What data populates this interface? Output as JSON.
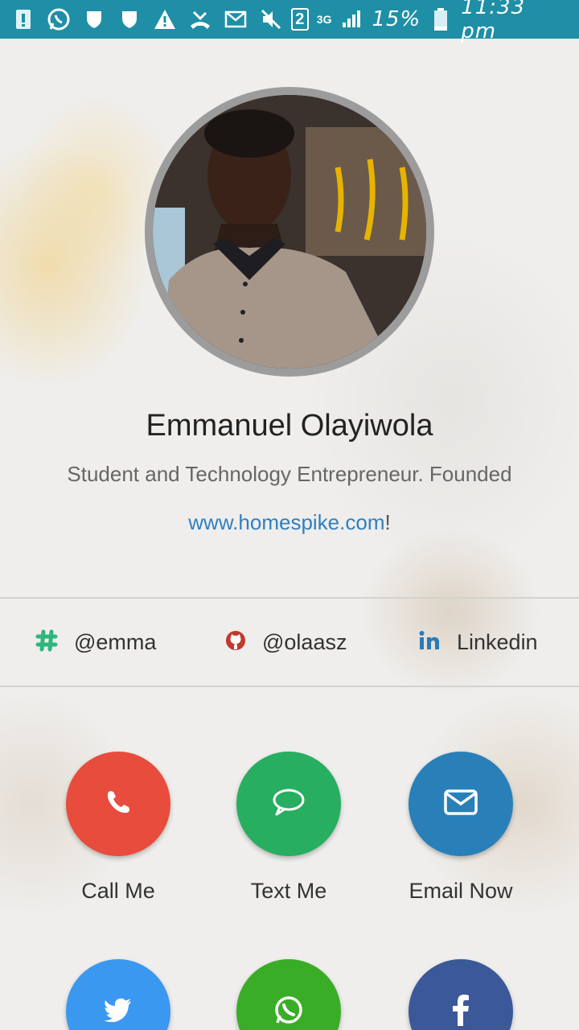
{
  "status_bar": {
    "battery_percent": "15%",
    "time": "11:33 pm",
    "network": "3G",
    "sim_slot": "2",
    "background_color": "#1e8fa6"
  },
  "profile": {
    "name": "Emmanuel Olayiwola",
    "bio": "Student and Technology Entrepreneur. Founded",
    "website": "www.homespike.com",
    "website_suffix": "!"
  },
  "socials": [
    {
      "icon": "slack-hash-icon",
      "label": "@emma",
      "color": "#2eb67d"
    },
    {
      "icon": "github-icon",
      "label": "@olaasz",
      "color": "#c0392b"
    },
    {
      "icon": "linkedin-icon",
      "label": "Linkedin",
      "color": "#2a7bb7"
    }
  ],
  "actions": [
    {
      "icon": "phone-icon",
      "label": "Call Me",
      "color": "#e74c3c"
    },
    {
      "icon": "chat-bubble-icon",
      "label": "Text Me",
      "color": "#27ae60"
    },
    {
      "icon": "envelope-icon",
      "label": "Email Now",
      "color": "#2980b9"
    }
  ],
  "actions_row2": [
    {
      "icon": "twitter-icon",
      "color": "#3b98f0"
    },
    {
      "icon": "whatsapp-icon",
      "color": "#3aad27"
    },
    {
      "icon": "facebook-icon",
      "color": "#3b5998"
    }
  ]
}
